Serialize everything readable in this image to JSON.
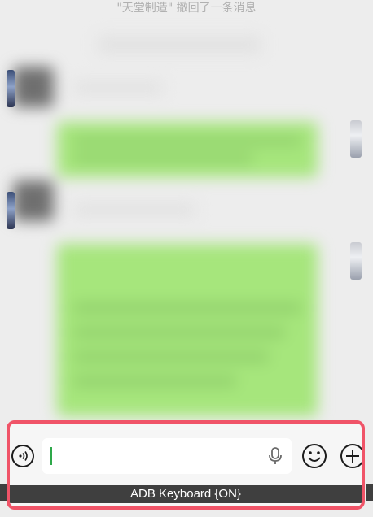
{
  "chat": {
    "recall_notice": "\"天堂制造\" 撤回了一条消息"
  },
  "input_bar": {
    "text_value": "",
    "voice_icon": "voice-wave-icon",
    "mic_icon": "microphone-icon",
    "emoji_icon": "emoji-icon",
    "plus_icon": "plus-icon"
  },
  "keyboard": {
    "status_label": "ADB Keyboard {ON}"
  },
  "colors": {
    "highlight_border": "#f05468",
    "bubble_green": "#a6e67c",
    "cursor_green": "#2ea84a",
    "background": "#ededed"
  }
}
